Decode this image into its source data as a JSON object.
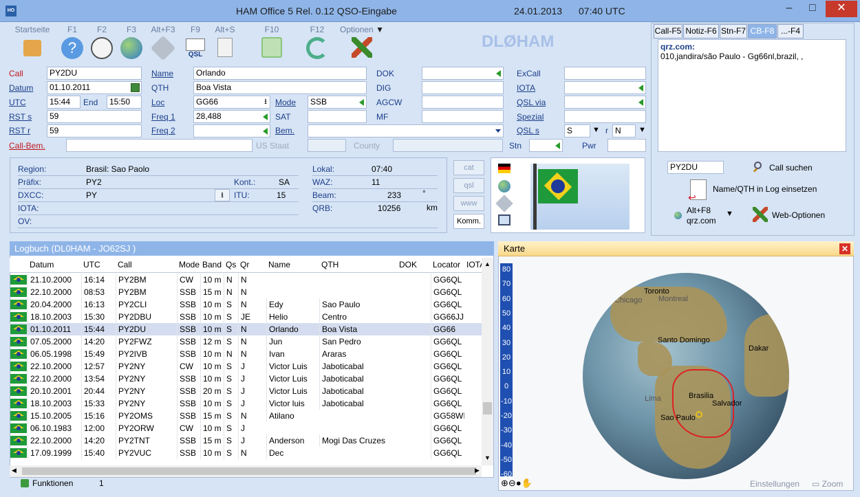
{
  "window": {
    "title": "HAM Office 5  Rel. 0.12   QSO-Eingabe",
    "date": "24.01.2013",
    "time": "07:40 UTC",
    "icon": "HO"
  },
  "toolbar": [
    {
      "key": "Startseite",
      "icon": "home-icon"
    },
    {
      "key": "F1",
      "icon": "help-icon"
    },
    {
      "key": "F2",
      "icon": "clock-icon"
    },
    {
      "key": "F3",
      "icon": "globe-icon"
    },
    {
      "key": "Alt+F3",
      "icon": "satellite-icon"
    },
    {
      "key": "F9",
      "icon": "qsl-card-icon",
      "sub": "QSL"
    },
    {
      "key": "Alt+S",
      "icon": "statistics-icon"
    },
    {
      "key": "F10",
      "icon": "save-icon"
    },
    {
      "key": "F12",
      "icon": "refresh-icon"
    },
    {
      "key": "Optionen",
      "icon": "tools-icon"
    }
  ],
  "callsign_logo": "DLØHAM",
  "form": {
    "call_label": "Call",
    "call": "PY2DU",
    "datum_label": "Datum",
    "datum": "01.10.2011",
    "utc_label": "UTC",
    "utc": "15:44",
    "end_label": "End",
    "end": "15:50",
    "rsts_label": "RST s",
    "rsts": "59",
    "rstr_label": "RST r",
    "rstr": "59",
    "callbem_label": "Call-Bem.",
    "callbem": "",
    "name_label": "Name",
    "name": "Orlando",
    "qth_label": "QTH",
    "qth": "Boa  Vista",
    "loc_label": "Loc",
    "loc": "GG66",
    "mode_label": "Mode",
    "mode": "SSB",
    "freq1_label": "Freq 1",
    "freq1": "28,488",
    "sat_label": "SAT",
    "sat": "",
    "freq2_label": "Freq 2",
    "freq2": "",
    "bem_label": "Bem.",
    "bem": "",
    "usstaat_label": "US Staat",
    "county_label": "County",
    "dok_label": "DOK",
    "dok": "",
    "dig_label": "DIG",
    "dig": "",
    "agcw_label": "AGCW",
    "agcw": "",
    "mf_label": "MF",
    "mf": "",
    "excall_label": "ExCall",
    "excall": "",
    "iota_label": "IOTA",
    "iota": "",
    "qslvia_label": "QSL via",
    "qslvia": "",
    "spezial_label": "Spezial",
    "spezial": "",
    "qsls_label": "QSL s",
    "qsls": "S",
    "r_label": "r",
    "qslr": "N",
    "stn_label": "Stn",
    "stn": "",
    "pwr_label": "Pwr",
    "pwr": ""
  },
  "info": {
    "region_label": "Region:",
    "region": "Brasil: Sao Paolo",
    "praefix_label": "Präfix:",
    "praefix": "PY2",
    "dxcc_label": "DXCC:",
    "dxcc": "PY",
    "iota_label": "IOTA:",
    "iota": "",
    "ov_label": "OV:",
    "ov": "",
    "kont_label": "Kont.:",
    "kont": "SA",
    "itu_label": "ITU:",
    "itu": "15",
    "lokal_label": "Lokal:",
    "lokal": "07:40",
    "waz_label": "WAZ:",
    "waz": "11",
    "beam_label": "Beam:",
    "beam": "233",
    "beam_unit": "°",
    "qrb_label": "QRB:",
    "qrb": "10256",
    "qrb_unit": "km"
  },
  "side_buttons": [
    "cat",
    "qsl",
    "www",
    "Komm."
  ],
  "right_panel": {
    "tabs": [
      "Call-F5",
      "Notiz-F6",
      "Stn-F7",
      "CB-F8",
      "...-F4"
    ],
    "active_tab": 3,
    "qrz_title": "qrz.com:",
    "qrz_text": "010,jandira/são Paulo - Gg66nl,brazil, ,",
    "search_call": "PY2DU",
    "call_suchen": "Call suchen",
    "name_qth_insert": "Name/QTH in Log einsetzen",
    "altf8": "Alt+F8",
    "qrz_option": "qrz.com",
    "web_optionen": "Web-Optionen"
  },
  "logbook": {
    "title": "Logbuch  (DL0HAM - JO62SJ )",
    "columns": [
      "Datum",
      "UTC",
      "Call",
      "Mode",
      "Band",
      "Qs",
      "Qr",
      "Name",
      "QTH",
      "DOK",
      "Locator",
      "IOTA"
    ],
    "rows": [
      [
        "21.10.2000",
        "16:14",
        "PY2BM",
        "CW",
        "10 m",
        "N",
        "N",
        "",
        "",
        "",
        "GG6QL",
        ""
      ],
      [
        "22.10.2000",
        "08:53",
        "PY2BM",
        "SSB",
        "15 m",
        "N",
        "N",
        "",
        "",
        "",
        "GG6QL",
        ""
      ],
      [
        "20.04.2000",
        "16:13",
        "PY2CLI",
        "SSB",
        "10 m",
        "S",
        "N",
        "Edy",
        "Sao Paulo",
        "",
        "GG6QL",
        ""
      ],
      [
        "18.10.2003",
        "15:30",
        "PY2DBU",
        "SSB",
        "10 m",
        "S",
        "JE",
        "Helio",
        "Centro",
        "",
        "GG66JJ",
        ""
      ],
      [
        "01.10.2011",
        "15:44",
        "PY2DU",
        "SSB",
        "10 m",
        "S",
        "N",
        "Orlando",
        "Boa  Vista",
        "",
        "GG66",
        ""
      ],
      [
        "07.05.2000",
        "14:20",
        "PY2FWZ",
        "SSB",
        "12 m",
        "S",
        "N",
        "Jun",
        "San Pedro",
        "",
        "GG6QL",
        ""
      ],
      [
        "06.05.1998",
        "15:49",
        "PY2IVB",
        "SSB",
        "10 m",
        "N",
        "N",
        "Ivan",
        "Araras",
        "",
        "GG6QL",
        ""
      ],
      [
        "22.10.2000",
        "12:57",
        "PY2NY",
        "CW",
        "10 m",
        "S",
        "J",
        "Victor Luis",
        "Jaboticabal",
        "",
        "GG6QL",
        ""
      ],
      [
        "22.10.2000",
        "13:54",
        "PY2NY",
        "SSB",
        "10 m",
        "S",
        "J",
        "Victor Luis",
        "Jaboticabal",
        "",
        "GG6QL",
        ""
      ],
      [
        "20.10.2001",
        "20:44",
        "PY2NY",
        "SSB",
        "20 m",
        "S",
        "J",
        "Victor Luis",
        "Jaboticabal",
        "",
        "GG6QL",
        ""
      ],
      [
        "18.10.2003",
        "15:33",
        "PY2NY",
        "SSB",
        "10 m",
        "S",
        "J",
        "Victor luis",
        "Jaboticabal",
        "",
        "GG6QL",
        ""
      ],
      [
        "15.10.2005",
        "15:16",
        "PY2OMS",
        "SSB",
        "15 m",
        "S",
        "N",
        "Atilano",
        "",
        "",
        "GG58WI",
        ""
      ],
      [
        "06.10.1983",
        "12:00",
        "PY2ORW",
        "CW",
        "10 m",
        "S",
        "J",
        "",
        "",
        "",
        "GG6QL",
        ""
      ],
      [
        "22.10.2000",
        "14:20",
        "PY2TNT",
        "SSB",
        "15 m",
        "S",
        "J",
        "Anderson",
        "Mogi Das Cruzes",
        "",
        "GG6QL",
        ""
      ],
      [
        "17.09.1999",
        "15:40",
        "PY2VUC",
        "SSB",
        "10 m",
        "S",
        "N",
        "Dec",
        "",
        "",
        "GG6QL",
        ""
      ]
    ],
    "selected_row": 4
  },
  "status": {
    "funktionen": "Funktionen",
    "count": "1"
  },
  "map": {
    "title": "Karte",
    "lat_ticks": [
      "80",
      "70",
      "60",
      "50",
      "40",
      "30",
      "20",
      "10",
      "0",
      "-10",
      "-20",
      "-30",
      "-40",
      "-50",
      "-60"
    ],
    "labels": [
      "Toronto",
      "Chicago",
      "Montreal",
      "Santo Domingo",
      "Dakar",
      "Brasilia",
      "Salvador",
      "Sao Paulo",
      "Lima"
    ],
    "settings": "Einstellungen",
    "zoom": "Zoom"
  }
}
